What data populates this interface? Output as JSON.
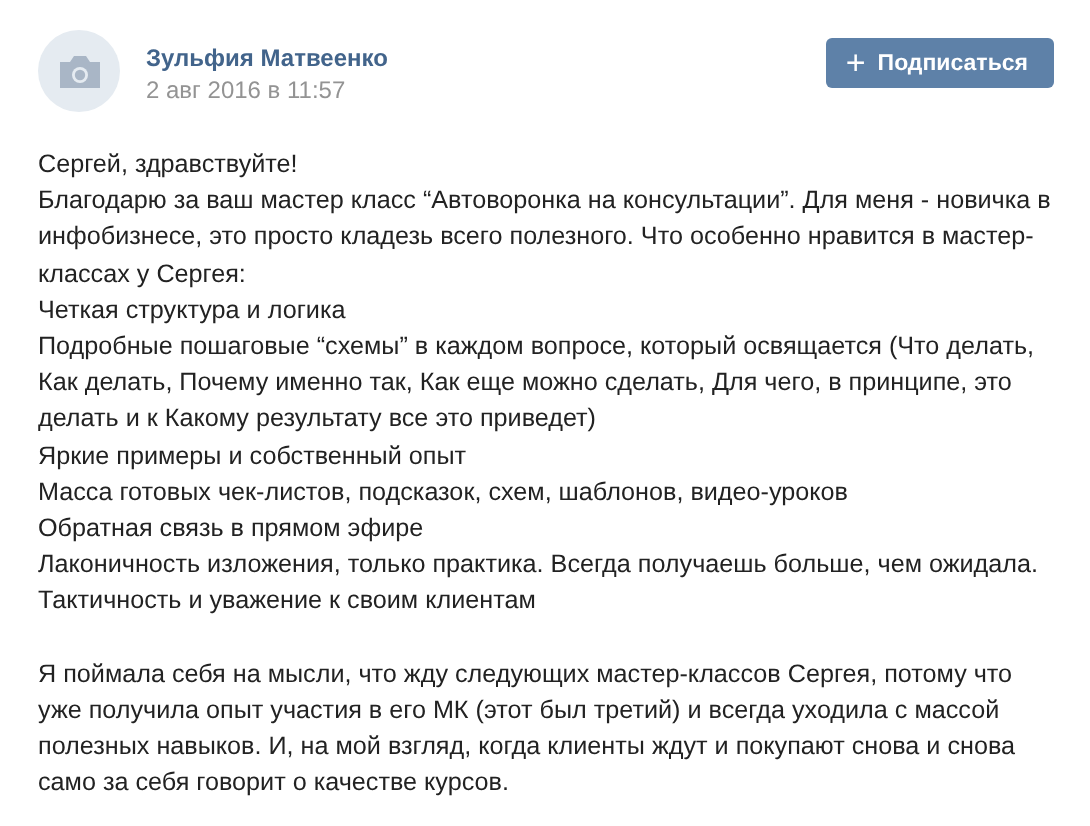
{
  "post": {
    "author": "Зульфия Матвеенко",
    "date": "2 авг 2016 в 11:57",
    "subscribe_button": {
      "icon": "+",
      "label": "Подписаться"
    }
  },
  "paragraphs": [
    {
      "lines": [
        "Сергей, здравствуйте!",
        "Благодарю за ваш мастер класс “Автоворонка на консультации”. Для меня - новичка в инфобизнесе, это просто кладезь всего полезного. Что особенно нравится в мастер-классах у Сергея:",
        "Четкая структура и логика",
        "Подробные пошаговые “схемы” в каждом вопросе, который освящается (Что делать, Как делать, Почему именно так, Как еще можно сделать, Для чего, в принципе, это делать и к Какому результату все это приведет)",
        "Яркие примеры и собственный опыт",
        "Масса готовых чек-листов, подсказок, схем, шаблонов, видео-уроков",
        "Обратная связь в прямом эфире",
        "Лаконичность изложения, только практика. Всегда получаешь больше, чем ожидала.",
        "Тактичность и уважение к своим клиентам"
      ]
    },
    {
      "lines": [
        "Я поймала себя на мысли, что жду следующих мастер-классов Сергея, потому что уже получила опыт участия в его МК (этот был третий) и всегда уходила с массой полезных навыков. И, на мой взгляд, когда клиенты ждут и покупают снова и снова само за себя говорит о качестве курсов."
      ]
    }
  ]
}
